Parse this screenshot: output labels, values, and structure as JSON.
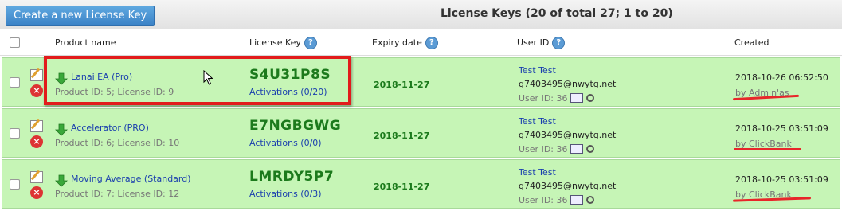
{
  "toolbar": {
    "create_label": "Create a new License Key"
  },
  "table": {
    "title": "License Keys (20 of total 27; 1 to 20)",
    "headers": {
      "product": "Product name",
      "key": "License Key",
      "expiry": "Expiry date",
      "user": "User ID",
      "created": "Created"
    },
    "rows": [
      {
        "product": "Lanai EA (Pro)",
        "meta": "Product ID: 5; License ID: 9",
        "key": "S4U31P8S",
        "activations": "Activations (0/20)",
        "expiry": "2018-11-27",
        "user_name": "Test Test",
        "user_email": "g7403495@nwytg.net",
        "user_id": "User ID: 36",
        "created": "2018-10-26 06:52:50",
        "by": "by Admin'as"
      },
      {
        "product": "Accelerator (PRO)",
        "meta": "Product ID: 6; License ID: 10",
        "key": "E7NGBGWG",
        "activations": "Activations (0/0)",
        "expiry": "2018-11-27",
        "user_name": "Test Test",
        "user_email": "g7403495@nwytg.net",
        "user_id": "User ID: 36",
        "created": "2018-10-25 03:51:09",
        "by": "by ClickBank"
      },
      {
        "product": "Moving Average (Standard)",
        "meta": "Product ID: 7; License ID: 12",
        "key": "LMRDY5P7",
        "activations": "Activations (0/3)",
        "expiry": "2018-11-27",
        "user_name": "Test Test",
        "user_email": "g7403495@nwytg.net",
        "user_id": "User ID: 36",
        "created": "2018-10-25 03:51:09",
        "by": "by ClickBank"
      }
    ]
  },
  "colors": {
    "row_bg": "#c6f5b6",
    "highlight": "#e21b1b",
    "accent": "#3b82c6",
    "key_green": "#1c7a1c"
  },
  "icons": [
    "help-icon",
    "edit-icon",
    "delete-icon",
    "green-arrow-icon",
    "user-card-icon",
    "badge-icon",
    "mouse-cursor-icon"
  ]
}
